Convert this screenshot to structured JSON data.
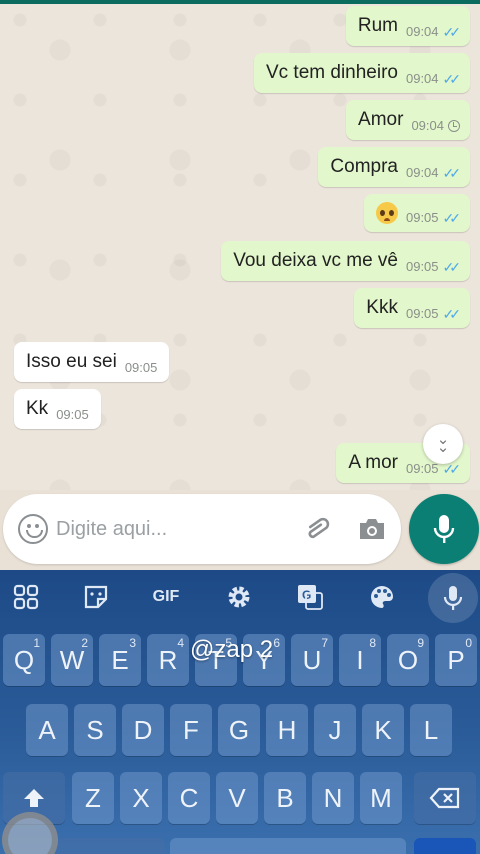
{
  "messages": [
    {
      "dir": "out",
      "text": "Rum",
      "time": "09:04",
      "status": "read"
    },
    {
      "dir": "out",
      "text": "Vc tem dinheiro",
      "time": "09:04",
      "status": "read"
    },
    {
      "dir": "out",
      "text": "Amor",
      "time": "09:04",
      "status": "pending"
    },
    {
      "dir": "out",
      "text": "Compra",
      "time": "09:04",
      "status": "read"
    },
    {
      "dir": "out",
      "text": "",
      "emoji": "pleading-face",
      "time": "09:05",
      "status": "read"
    },
    {
      "dir": "out",
      "text": "Vou deixa vc me vê",
      "time": "09:05",
      "status": "read"
    },
    {
      "dir": "out",
      "text": "Kkk",
      "time": "09:05",
      "status": "read"
    },
    {
      "dir": "in",
      "text": "Isso eu sei",
      "time": "09:05"
    },
    {
      "dir": "in",
      "text": "Kk",
      "time": "09:05"
    },
    {
      "dir": "out",
      "text": "A mor",
      "time": "09:05",
      "status": "read"
    }
  ],
  "input": {
    "placeholder": "Digite aqui..."
  },
  "keyboard": {
    "toolbar": [
      "apps-grid-icon",
      "sticker-icon",
      "GIF",
      "gear-icon",
      "translate-icon",
      "palette-icon",
      "mic-icon"
    ],
    "gif_label": "GIF",
    "row1": [
      {
        "k": "Q",
        "h": "1"
      },
      {
        "k": "W",
        "h": "2"
      },
      {
        "k": "E",
        "h": "3"
      },
      {
        "k": "R",
        "h": "4"
      },
      {
        "k": "T",
        "h": "5"
      },
      {
        "k": "Y",
        "h": "6"
      },
      {
        "k": "U",
        "h": "7"
      },
      {
        "k": "I",
        "h": "8"
      },
      {
        "k": "O",
        "h": "9"
      },
      {
        "k": "P",
        "h": "0"
      }
    ],
    "row2": [
      "A",
      "S",
      "D",
      "F",
      "G",
      "H",
      "J",
      "K",
      "L"
    ],
    "row3": [
      "Z",
      "X",
      "C",
      "V",
      "B",
      "N",
      "M"
    ]
  },
  "watermark": "@zap 2",
  "colors": {
    "outgoing": "#e2f7cb",
    "incoming": "#ffffff",
    "read_ticks": "#4fa9e8",
    "mic_button": "#0b7f73",
    "keyboard": "#2a5b98"
  }
}
